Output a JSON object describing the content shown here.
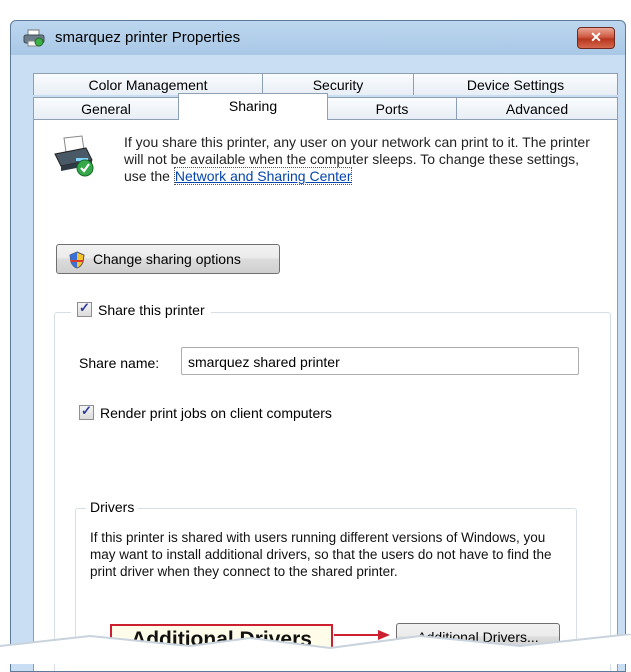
{
  "window": {
    "title": "smarquez printer Properties",
    "close_label": "✕"
  },
  "tabs": {
    "back_row": [
      "Color Management",
      "Security",
      "Device Settings"
    ],
    "front_row": [
      "General",
      "Sharing",
      "Ports",
      "Advanced"
    ],
    "active": "Sharing"
  },
  "sharing": {
    "intro_text": "If you share this printer, any user on your network can print to it. The printer will not be available when the computer sleeps. To change these settings, use the ",
    "intro_link": "Network and Sharing Center",
    "intro_end": ".",
    "change_button": "Change sharing options",
    "share_checkbox_label": "Share this printer",
    "share_checked": true,
    "share_name_label": "Share name:",
    "share_name_value": "smarquez shared printer",
    "render_label": "Render print jobs on client computers",
    "render_checked": true
  },
  "drivers": {
    "legend": "Drivers",
    "text": "If this printer is shared with users running different versions of Windows, you may want to install additional drivers, so that the users do not have to find the print driver when they connect to the shared printer.",
    "button": "Additional Drivers..."
  },
  "callout": {
    "label": "Additional Drivers"
  },
  "colors": {
    "accent_red": "#cc1f2f",
    "link_blue": "#0645ad"
  }
}
